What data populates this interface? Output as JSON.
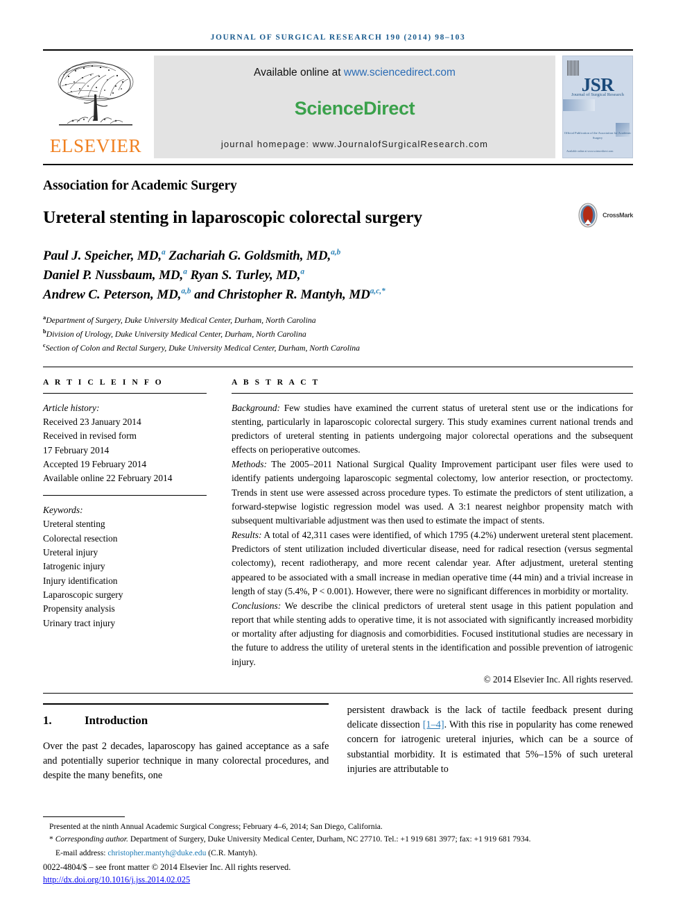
{
  "running_head": "JOURNAL OF SURGICAL RESEARCH 190 (2014) 98–103",
  "masthead": {
    "elsevier_wordmark": "ELSEVIER",
    "available_online_prefix": "Available online at ",
    "sciencedirect_url": "www.sciencedirect.com",
    "sciencedirect_logo": "ScienceDirect",
    "journal_homepage": "journal homepage: www.JournalofSurgicalResearch.com",
    "cover": {
      "acronym": "JSR",
      "subtitle": "Journal of Surgical Research",
      "society_note": "Official Publication of the Association for Academic Surgery",
      "bottom_note": "Available online at www.sciencedirect.com"
    }
  },
  "society": "Association for Academic Surgery",
  "title": "Ureteral stenting in laparoscopic colorectal surgery",
  "crossmark_label": "CrossMark",
  "authors_lines": [
    "Paul J. Speicher, MD,",
    "Zachariah G. Goldsmith, MD,",
    "Daniel P. Nussbaum, MD,",
    "Ryan S. Turley, MD,",
    "Andrew C. Peterson, MD,",
    "and Christopher R. Mantyh, MD"
  ],
  "author_marks": [
    "a",
    "a,b",
    "a",
    "a",
    "a,b",
    "a,c,*"
  ],
  "affiliations": [
    {
      "mark": "a",
      "text": "Department of Surgery, Duke University Medical Center, Durham, North Carolina"
    },
    {
      "mark": "b",
      "text": "Division of Urology, Duke University Medical Center, Durham, North Carolina"
    },
    {
      "mark": "c",
      "text": "Section of Colon and Rectal Surgery, Duke University Medical Center, Durham, North Carolina"
    }
  ],
  "article_info": {
    "heading": "A R T I C L E   I N F O",
    "history_label": "Article history:",
    "history": [
      "Received 23 January 2014",
      "Received in revised form",
      "17 February 2014",
      "Accepted 19 February 2014",
      "Available online 22 February 2014"
    ],
    "keywords_label": "Keywords:",
    "keywords": [
      "Ureteral stenting",
      "Colorectal resection",
      "Ureteral injury",
      "Iatrogenic injury",
      "Injury identification",
      "Laparoscopic surgery",
      "Propensity analysis",
      "Urinary tract injury"
    ]
  },
  "abstract": {
    "heading": "A B S T R A C T",
    "sections": [
      {
        "label": "Background:",
        "text": " Few studies have examined the current status of ureteral stent use or the indications for stenting, particularly in laparoscopic colorectal surgery. This study examines current national trends and predictors of ureteral stenting in patients undergoing major colorectal operations and the subsequent effects on perioperative outcomes."
      },
      {
        "label": "Methods:",
        "text": " The 2005–2011 National Surgical Quality Improvement participant user files were used to identify patients undergoing laparoscopic segmental colectomy, low anterior resection, or proctectomy. Trends in stent use were assessed across procedure types. To estimate the predictors of stent utilization, a forward-stepwise logistic regression model was used. A 3:1 nearest neighbor propensity match with subsequent multivariable adjustment was then used to estimate the impact of stents."
      },
      {
        "label": "Results:",
        "text": " A total of 42,311 cases were identified, of which 1795 (4.2%) underwent ureteral stent placement. Predictors of stent utilization included diverticular disease, need for radical resection (versus segmental colectomy), recent radiotherapy, and more recent calendar year. After adjustment, ureteral stenting appeared to be associated with a small increase in median operative time (44 min) and a trivial increase in length of stay (5.4%, P < 0.001). However, there were no significant differences in morbidity or mortality."
      },
      {
        "label": "Conclusions:",
        "text": " We describe the clinical predictors of ureteral stent usage in this patient population and report that while stenting adds to operative time, it is not associated with significantly increased morbidity or mortality after adjusting for diagnosis and comorbidities. Focused institutional studies are necessary in the future to address the utility of ureteral stents in the identification and possible prevention of iatrogenic injury."
      }
    ],
    "copyright": "© 2014 Elsevier Inc. All rights reserved."
  },
  "introduction": {
    "number": "1.",
    "title": "Introduction",
    "left_text": "Over the past 2 decades, laparoscopy has gained acceptance as a safe and potentially superior technique in many colorectal procedures, and despite the many benefits, one",
    "right_text_pre": "persistent drawback is the lack of tactile feedback present during delicate dissection ",
    "right_citation": "[1–4]",
    "right_text_post": ". With this rise in popularity has come renewed concern for iatrogenic ureteral injuries, which can be a source of substantial morbidity. It is estimated that 5%–15% of such ureteral injuries are attributable to"
  },
  "footnotes": {
    "presented": "Presented at the ninth Annual Academic Surgical Congress; February 4–6, 2014; San Diego, California.",
    "corresponding_mark": "*",
    "corresponding_label": "Corresponding author.",
    "corresponding_text": " Department of Surgery, Duke University Medical Center, Durham, NC 27710. Tel.: +1 919 681 3977; fax: +1 919 681 7934.",
    "email_label": "E-mail address: ",
    "email": "christopher.mantyh@duke.edu",
    "email_suffix": " (C.R. Mantyh).",
    "issn_line": "0022-4804/$ – see front matter © 2014 Elsevier Inc. All rights reserved.",
    "doi": "http://dx.doi.org/10.1016/j.jss.2014.02.025"
  }
}
